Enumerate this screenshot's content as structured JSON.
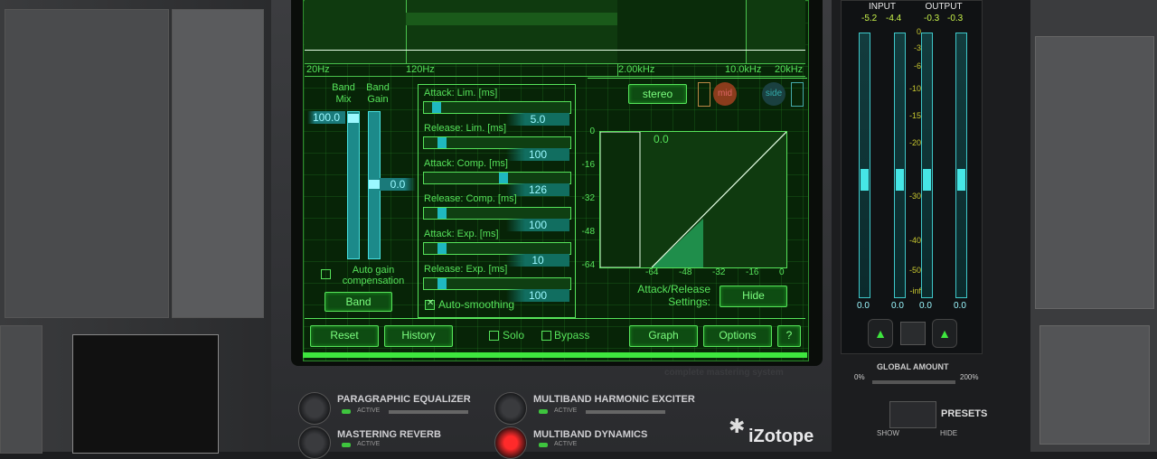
{
  "eq_freqs": [
    "20Hz",
    "120Hz",
    "2.00kHz",
    "10.0kHz",
    "20kHz"
  ],
  "band": {
    "mix_label": "Band\nMix",
    "gain_label": "Band\nGain",
    "mix_value": "100.0",
    "gain_value": "0.0",
    "auto_gain": "Auto gain compensation",
    "band_button": "Band"
  },
  "timing": [
    {
      "label": "Attack: Lim. [ms]",
      "value": "5.0",
      "fraction": 0.06
    },
    {
      "label": "Release: Lim. [ms]",
      "value": "100",
      "fraction": 0.1
    },
    {
      "label": "Attack: Comp. [ms]",
      "value": "126",
      "fraction": 0.55
    },
    {
      "label": "Release: Comp. [ms]",
      "value": "100",
      "fraction": 0.1
    },
    {
      "label": "Attack: Exp. [ms]",
      "value": "10",
      "fraction": 0.1
    },
    {
      "label": "Release: Exp. [ms]",
      "value": "100",
      "fraction": 0.1
    }
  ],
  "auto_smoothing": "Auto-smoothing",
  "stereo_button": "stereo",
  "mid_label": "mid",
  "side_label": "side",
  "graph": {
    "value": "0.0",
    "y_ticks": [
      "0",
      "-16",
      "-32",
      "-48",
      "-64"
    ],
    "x_ticks": [
      "-64",
      "-48",
      "-32",
      "-16",
      "0"
    ],
    "settings_label": "Attack/Release\nSettings:",
    "hide_button": "Hide"
  },
  "bottom_bar": {
    "reset": "Reset",
    "history": "History",
    "solo": "Solo",
    "bypass": "Bypass",
    "graph": "Graph",
    "options": "Options",
    "help": "?"
  },
  "meter": {
    "input_label": "INPUT",
    "output_label": "OUTPUT",
    "in_l": "-5.2",
    "in_r": "-4.4",
    "out_l": "-0.3",
    "out_r": "-0.3",
    "scale": [
      "0",
      "-3",
      "-6",
      "-10",
      "-15",
      "-20",
      "-30",
      "-40",
      "-50",
      "-inf"
    ],
    "bottoms": [
      "0.0",
      "0.0",
      "0.0",
      "0.0"
    ],
    "levels": [
      0.44,
      0.44,
      0.44,
      0.44
    ]
  },
  "global_amount": {
    "label": "GLOBAL AMOUNT",
    "min": "0%",
    "max": "200%"
  },
  "presets": {
    "label": "PRESETS",
    "show": "SHOW",
    "hide": "HIDE"
  },
  "modules": [
    {
      "name": "PARAGRAPHIC EQUALIZER",
      "status": "ACTIVE"
    },
    {
      "name": "MULTIBAND HARMONIC EXCITER",
      "status": "ACTIVE"
    },
    {
      "name": "MASTERING REVERB",
      "status": "ACTIVE"
    },
    {
      "name": "MULTIBAND DYNAMICS",
      "status": "ACTIVE"
    }
  ],
  "brand": "iZotope",
  "tagline": "complete mastering system"
}
